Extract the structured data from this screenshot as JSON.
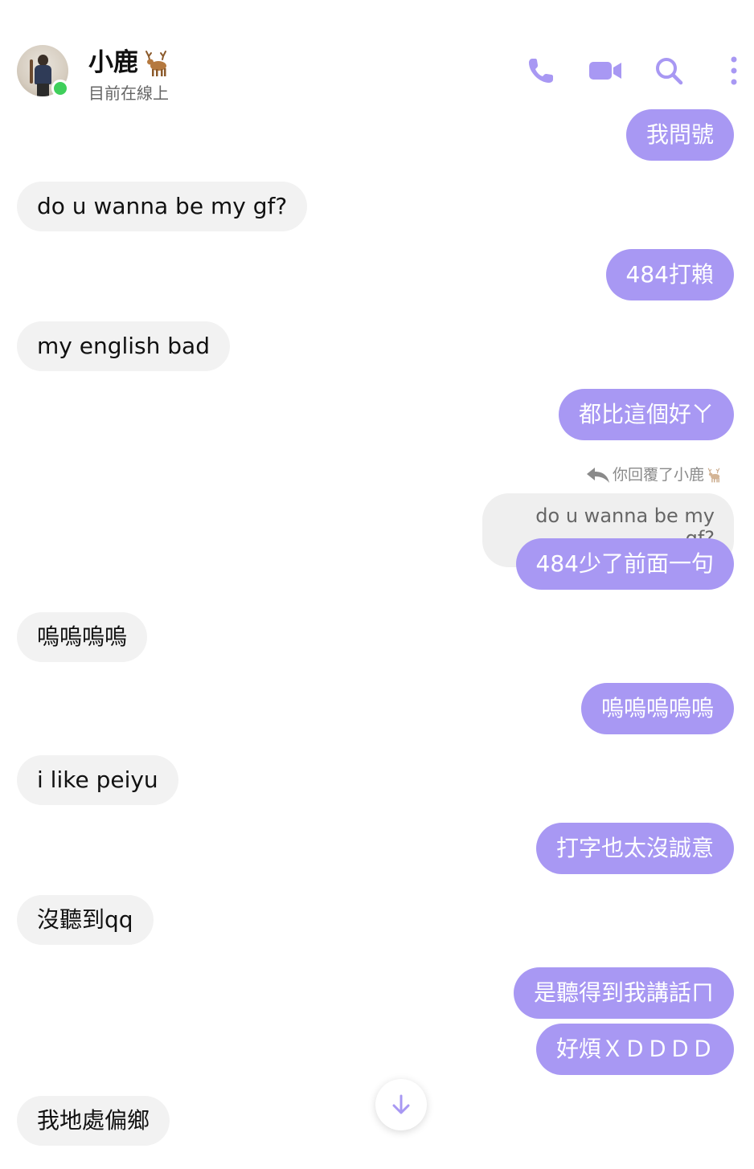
{
  "header": {
    "contact_name": "小鹿",
    "status": "目前在線上"
  },
  "messages": [
    {
      "dir": "out",
      "text": "我問號"
    },
    {
      "dir": "in",
      "text": "do u wanna be my gf?"
    },
    {
      "dir": "out",
      "text": "484打賴"
    },
    {
      "dir": "in",
      "text": "my english bad"
    },
    {
      "dir": "out",
      "text": "都比這個好ㄚ"
    },
    {
      "dir": "out",
      "text": "484少了前面一句",
      "reply_label": "你回覆了小鹿",
      "reply_quote": "do u wanna be my gf?"
    },
    {
      "dir": "in",
      "text": "嗚嗚嗚嗚"
    },
    {
      "dir": "out",
      "text": "嗚嗚嗚嗚嗚"
    },
    {
      "dir": "in",
      "text": "i like peiyu"
    },
    {
      "dir": "out",
      "text": "打字也太沒誠意"
    },
    {
      "dir": "in",
      "text": "沒聽到qq"
    },
    {
      "dir": "out",
      "text": "是聽得到我講話ㄇ"
    },
    {
      "dir": "out",
      "text": "好煩ＸＤＤＤＤ"
    },
    {
      "dir": "in",
      "text": "我地處偏鄉"
    }
  ],
  "colors": {
    "accent": "#a898f3",
    "incoming_bubble": "#f2f2f2",
    "online": "#3fcf5b"
  },
  "icons": [
    "phone-icon",
    "video-icon",
    "search-icon",
    "more-icon",
    "reply-icon",
    "deer-icon",
    "arrow-down-icon"
  ]
}
